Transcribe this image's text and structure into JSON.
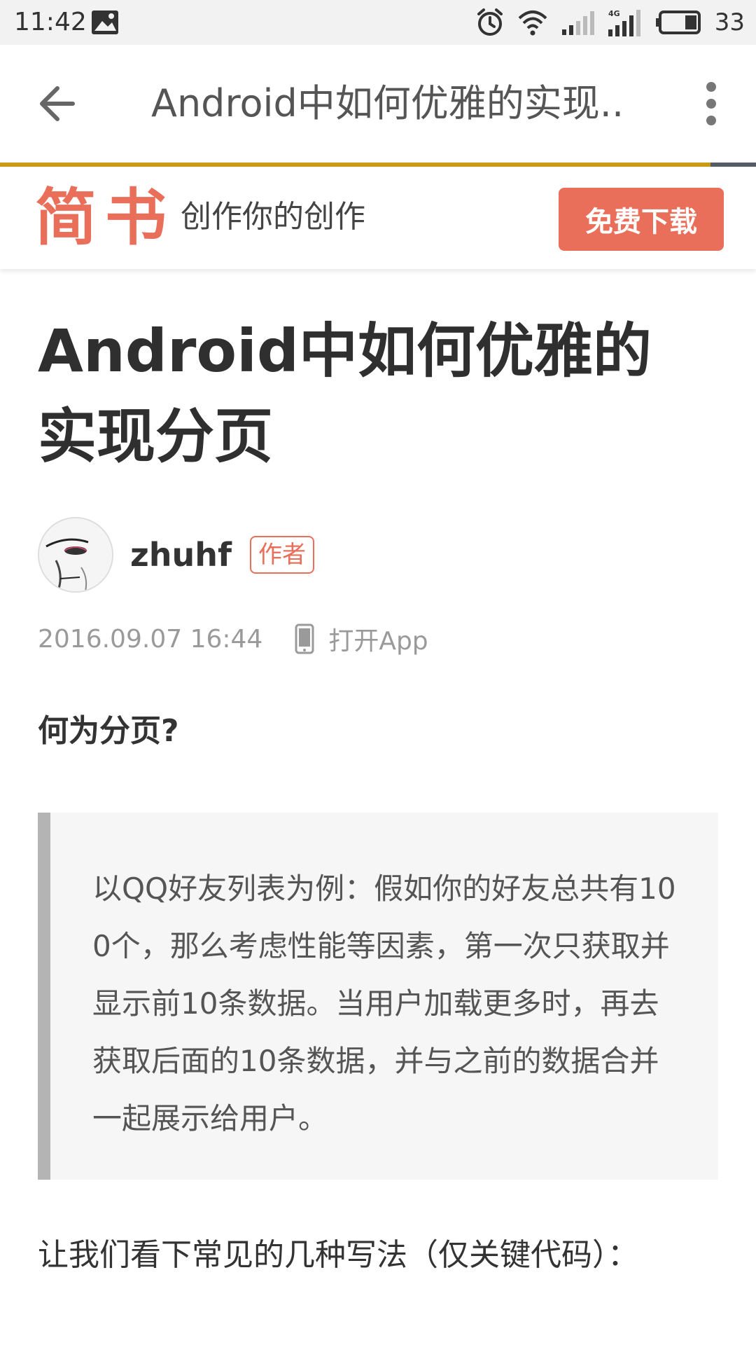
{
  "status_bar": {
    "time": "11:42",
    "battery": "33",
    "network": "4G"
  },
  "toolbar": {
    "title": "Android中如何优雅的实现..",
    "progress_percent": 94
  },
  "banner": {
    "logo": "简书",
    "slogan": "创作你的创作",
    "download_label": "免费下载"
  },
  "article": {
    "title": "Android中如何优雅的实现分页",
    "author": "zhuhf",
    "author_badge": "作者",
    "date": "2016.09.07 16:44",
    "open_app": "打开App",
    "section_heading": "何为分页?",
    "quote": "以QQ好友列表为例：假如你的好友总共有100个，那么考虑性能等因素，第一次只获取并显示前10条数据。当用户加载更多时，再去获取后面的10条数据，并与之前的数据合并一起展示给用户。",
    "paragraph": "让我们看下常见的几种写法（仅关键代码）："
  },
  "colors": {
    "accent": "#ea6f5a",
    "progress": "#c99a12"
  },
  "icons": {
    "back": "arrow-left-icon",
    "more": "more-vert-icon",
    "phone": "phone-icon",
    "alarm": "alarm-icon",
    "wifi": "wifi-icon",
    "signal": "signal-icon",
    "battery": "battery-icon"
  }
}
